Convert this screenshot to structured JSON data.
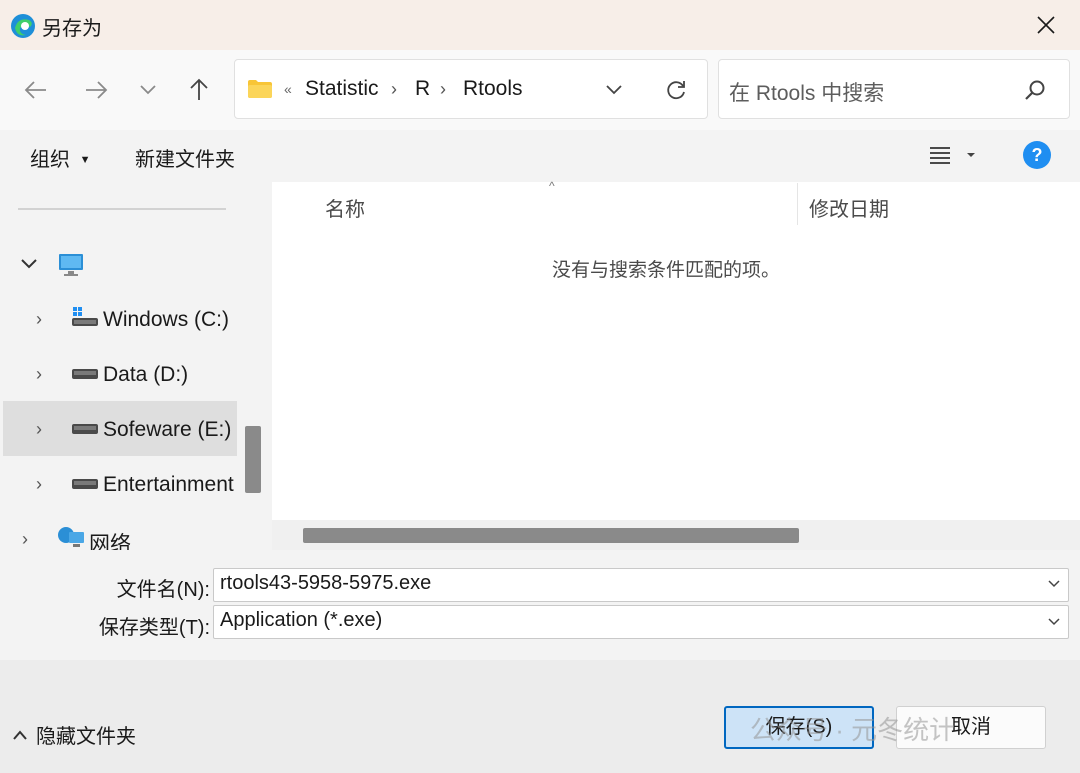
{
  "window": {
    "title": "另存为",
    "close_label": "×"
  },
  "address": {
    "overflow": "«",
    "crumbs": [
      "Statistic",
      "R",
      "Rtools"
    ]
  },
  "search": {
    "placeholder": "在 Rtools 中搜索"
  },
  "toolbar": {
    "organize_label": "组织",
    "new_folder_label": "新建文件夹",
    "help_label": "?"
  },
  "sidebar": {
    "items": [
      {
        "label": "Windows (C:)",
        "icon": "windows-drive-icon"
      },
      {
        "label": "Data (D:)",
        "icon": "drive-icon"
      },
      {
        "label": "Sofeware (E:)",
        "icon": "drive-icon",
        "selected": true
      },
      {
        "label": "Entertainment",
        "icon": "drive-icon"
      },
      {
        "label": "网络",
        "icon": "network-icon"
      }
    ]
  },
  "columns": {
    "name": "名称",
    "modified": "修改日期"
  },
  "empty_message": "没有与搜索条件匹配的项。",
  "file_form": {
    "filename_label": "文件名(N):",
    "filename_value": "rtools43-5958-5975.exe",
    "filetype_label": "保存类型(T):",
    "filetype_value": "Application (*.exe)"
  },
  "footer": {
    "hide_folders_label": "隐藏文件夹",
    "save_label": "保存(S)",
    "cancel_label": "取消"
  },
  "watermark": "公众号 · 元冬统计",
  "colors": {
    "accent": "#0067c0",
    "save_bg": "#cde3f7",
    "help_blue": "#1f8ef1",
    "folder_yellow": "#f8c537"
  }
}
